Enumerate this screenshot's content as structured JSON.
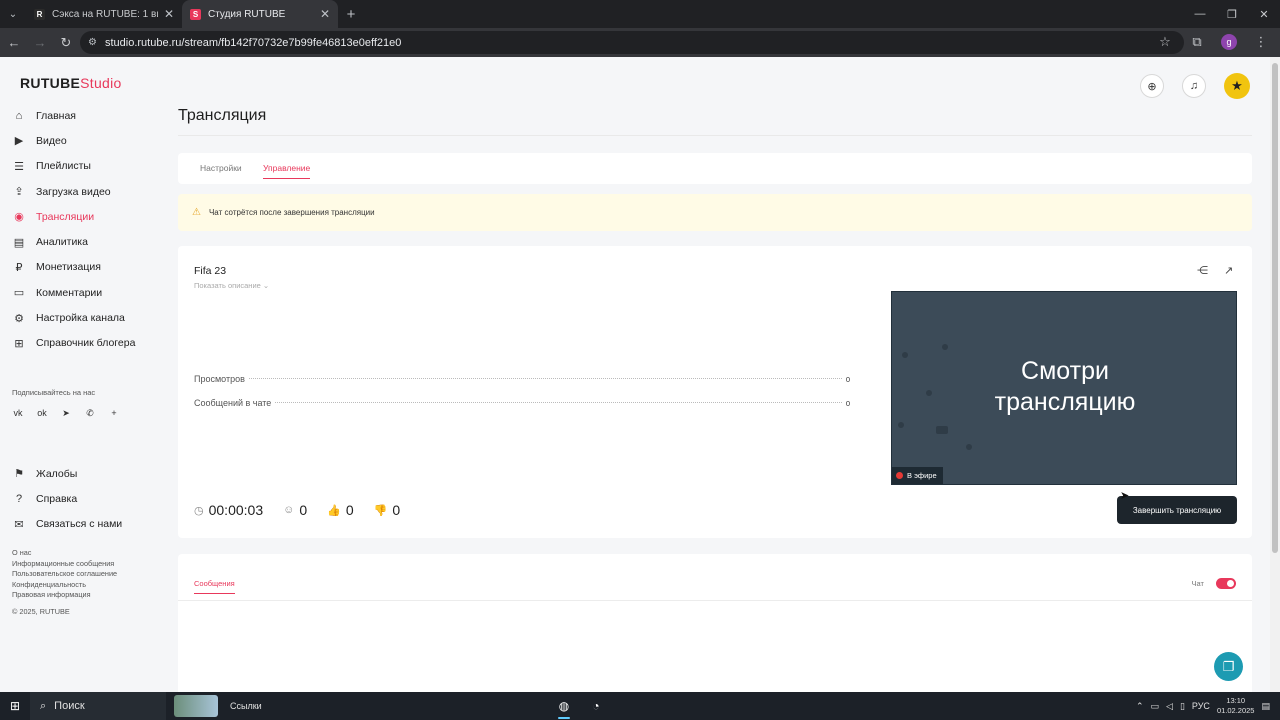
{
  "browser": {
    "tabs": [
      {
        "favicon": "R",
        "favicon_color": "#1f1f1f",
        "label": "Сэкса на RUTUBE: 1 видео – ...",
        "active": false
      },
      {
        "favicon": "S",
        "favicon_color": "#e8385b",
        "label": "Студия RUTUBE",
        "active": true
      }
    ],
    "url": "studio.rutube.ru/stream/fb142f70732e7b99fe46813e0eff21e0",
    "profile_initial": "g"
  },
  "sidebar": {
    "logo_main": "RUTUBE",
    "logo_sub": "Studio",
    "nav": [
      {
        "label": "Главная",
        "icon": "home-icon",
        "active": false
      },
      {
        "label": "Видео",
        "icon": "video-icon",
        "active": false
      },
      {
        "label": "Плейлисты",
        "icon": "playlist-icon",
        "active": false
      },
      {
        "label": "Загрузка видео",
        "icon": "upload-icon",
        "active": false
      },
      {
        "label": "Трансляции",
        "icon": "broadcast-icon",
        "active": true
      },
      {
        "label": "Аналитика",
        "icon": "analytics-icon",
        "active": false
      },
      {
        "label": "Монетизация",
        "icon": "monetization-icon",
        "active": false
      },
      {
        "label": "Комментарии",
        "icon": "comments-icon",
        "active": false
      },
      {
        "label": "Настройка канала",
        "icon": "settings-icon",
        "active": false
      },
      {
        "label": "Справочник блогера",
        "icon": "handbook-icon",
        "active": false
      }
    ],
    "subscribe_label": "Подписывайтесь на нас",
    "socials": [
      "vk-icon",
      "ok-icon",
      "telegram-icon",
      "viber-icon",
      "plus-icon"
    ],
    "nav2": [
      {
        "label": "Жалобы",
        "icon": "flag-icon"
      },
      {
        "label": "Справка",
        "icon": "help-icon"
      },
      {
        "label": "Связаться с нами",
        "icon": "mail-icon"
      }
    ],
    "footer_links": [
      "О нас",
      "Информационные сообщения",
      "Пользовательское соглашение",
      "Конфиденциальность",
      "Правовая информация"
    ],
    "copyright": "© 2025, RUTUBE"
  },
  "header": {
    "title": "Трансляция"
  },
  "page_tabs": [
    {
      "label": "Настройки",
      "active": false
    },
    {
      "label": "Управление",
      "active": true
    }
  ],
  "warning": {
    "text": "Чат сотрётся после завершения трансляции"
  },
  "stream": {
    "title": "Fifa 23",
    "show_description": "Показать описание",
    "stats": [
      {
        "label": "Просмотров",
        "value": "0"
      },
      {
        "label": "Сообщений в чате",
        "value": "0"
      }
    ],
    "duration": "00:00:03",
    "viewers": "0",
    "likes": "0",
    "dislikes": "0",
    "preview_text_line1": "Смотри",
    "preview_text_line2": "трансляцию",
    "live_badge": "В эфире",
    "end_button": "Завершить трансляцию"
  },
  "chat": {
    "tab_label": "Сообщения",
    "toggle_label": "Чат",
    "toggle_on": true
  },
  "taskbar": {
    "search_label": "Поиск",
    "widget_label": "Ссылки",
    "language": "РУС",
    "time": "13:10",
    "date": "01.02.2025"
  }
}
